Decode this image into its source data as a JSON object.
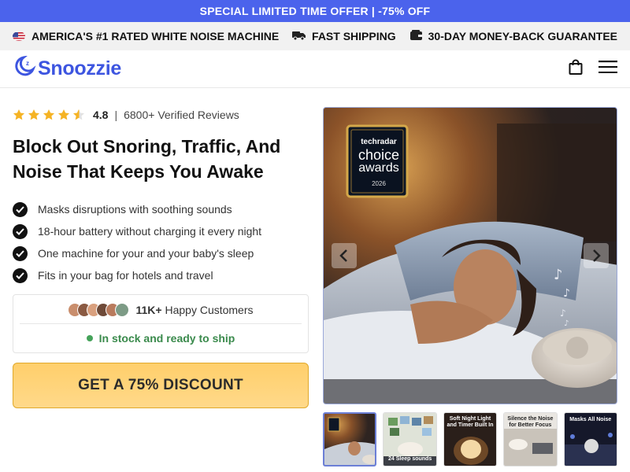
{
  "promo": {
    "text": "SPECIAL LIMITED TIME OFFER | -75% OFF"
  },
  "trust_bar": {
    "left": "AMERICA'S #1 RATED WHITE NOISE MACHINE",
    "shipping": "FAST SHIPPING",
    "guarantee": "30-DAY MONEY-BACK GUARANTEE"
  },
  "header": {
    "logo_text": "Snoozzie"
  },
  "rating": {
    "value": "4.8",
    "separator": "|",
    "reviews_text": "6800+ Verified Reviews",
    "stars": 4.5
  },
  "headline": "Block Out Snoring, Traffic, And Noise That Keeps You Awake",
  "benefits": [
    "Masks disruptions with soothing sounds",
    "18-hour battery without charging it every night",
    "One machine for your and your baby's sleep",
    "Fits in your bag for hotels and travel"
  ],
  "customers": {
    "count": "11K+",
    "label": "Happy Customers"
  },
  "stock": {
    "text": "In stock and ready to ship"
  },
  "cta": {
    "label": "GET A 75% DISCOUNT"
  },
  "gallery": {
    "badge_brand": "techradar",
    "badge_line1": "choice",
    "badge_line2": "awards",
    "badge_year": "2026",
    "thumbnails": [
      {
        "caption": ""
      },
      {
        "caption": "24 Sleep sounds"
      },
      {
        "caption": "Soft Night Light and Timer Built In"
      },
      {
        "caption": "Silence the Noise for Better Focus"
      },
      {
        "caption": "Masks All Noise"
      }
    ]
  },
  "colors": {
    "brand": "#3d55e0",
    "promo": "#4b63ec",
    "cta": "#ffd27a",
    "stock": "#3a8a4c",
    "star": "#f5b324"
  }
}
